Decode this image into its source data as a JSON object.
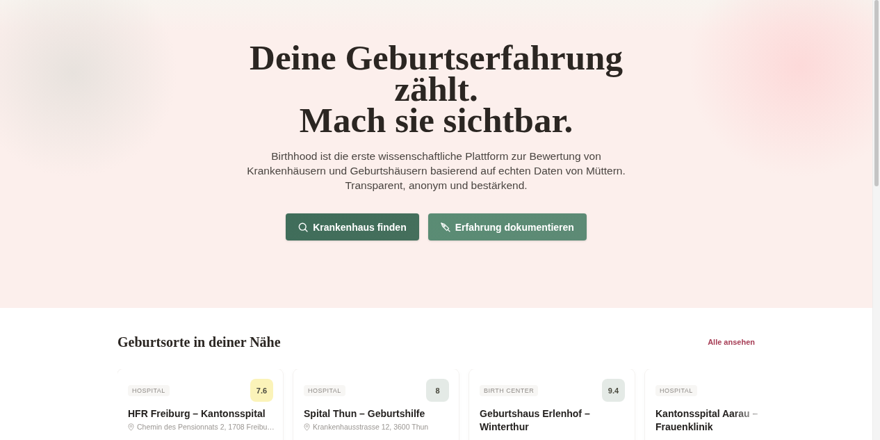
{
  "hero": {
    "title_lines": [
      "Deine Geburtserfahrung",
      "zählt.",
      "Mach sie sichtbar."
    ],
    "subtitle_lines": [
      "Birthhood ist die erste wissenschaftliche Plattform zur Bewertung von",
      "Krankenhäusern und Geburtshäusern basierend auf echten Daten von Müttern.",
      "Transparent, anonym und bestärkend."
    ],
    "buttons": [
      {
        "label": "Krankenhaus finden",
        "kind": "primary"
      },
      {
        "label": "Erfahrung dokumentieren",
        "kind": "secondary"
      }
    ]
  },
  "places": {
    "title": "Geburtsorte in deiner Nähe",
    "link": "Alle ansehen",
    "items": [
      {
        "category": "HOSPITAL",
        "score": "7.6",
        "color": "#fbf3b9",
        "name": "HFR Freiburg – Kantonsspital",
        "address": "Chemin des Pensionnats 2, 1708 Freibu…"
      },
      {
        "category": "HOSPITAL",
        "score": "8",
        "color": "#e4eae6",
        "name": "Spital Thun – Geburtshilfe",
        "address": "Krankenhausstrasse 12, 3600 Thun"
      },
      {
        "category": "BIRTH CENTER",
        "score": "9.4",
        "color": "#e4eae6",
        "name": "Geburtshaus Erlenhof – Winterthur"
      },
      {
        "category": "HOSPITAL",
        "name": "Kantonsspital Aarau – Frauenklinik"
      }
    ]
  }
}
